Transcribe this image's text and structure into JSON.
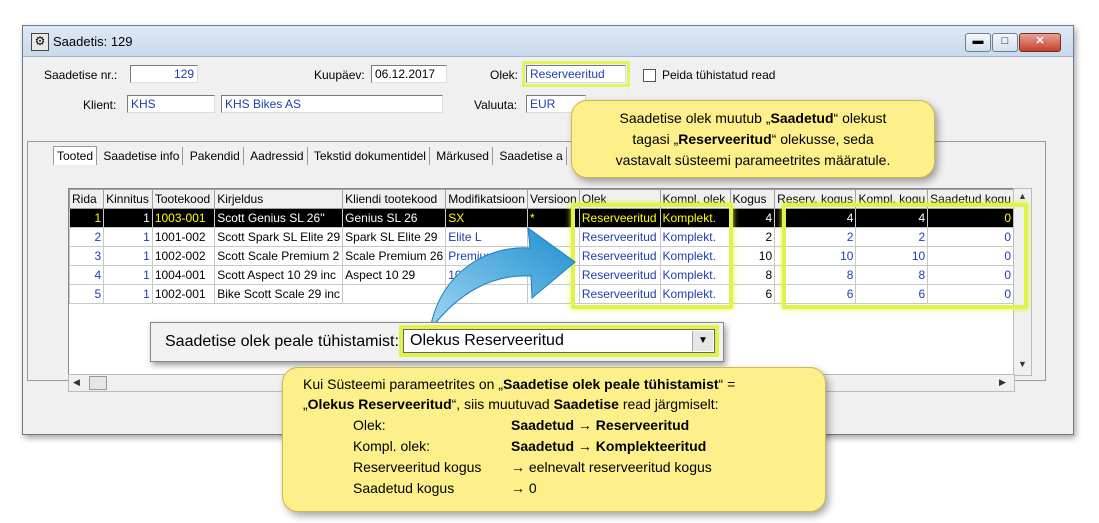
{
  "window": {
    "title": "Saadetis: 129",
    "buttons": {
      "minimize": "▬",
      "maximize": "□",
      "close": "✕"
    }
  },
  "header": {
    "saadetise_nr_label": "Saadetise nr.:",
    "saadetise_nr_value": "129",
    "kuupaev_label": "Kuupäev:",
    "kuupaev_value": "06.12.2017",
    "olek_label": "Olek:",
    "olek_value": "Reserveeritud",
    "peida_label": "Peida tühistatud read",
    "klient_label": "Klient:",
    "klient_code": "KHS",
    "klient_name": "KHS Bikes AS",
    "valuuta_label": "Valuuta:",
    "valuuta_value": "EUR"
  },
  "tabs": [
    "Tooted",
    "Saadetise info",
    "Pakendid",
    "Aadressid",
    "Tekstid dokumentidel",
    "Märkused",
    "Saadetise a"
  ],
  "table": {
    "columns": [
      "Rida",
      "Kinnitus",
      "Tootekood",
      "Kirjeldus",
      "Kliendi tootekood",
      "Modifikatsioon",
      "Versioon",
      "Olek",
      "Kompl. olek",
      "Kogus",
      "Reserv. kogus",
      "Kompl. kogu",
      "Saadetud kogu"
    ],
    "rows": [
      [
        "1",
        "1",
        "1003-001",
        "Scott Genius SL 26''",
        "Genius SL 26",
        "SX",
        "*",
        "Reserveeritud",
        "Komplekt.",
        "4",
        "4",
        "4",
        "0"
      ],
      [
        "2",
        "1",
        "1001-002",
        "Scott Spark SL Elite 29",
        "Spark SL Elite 29",
        "Elite L",
        "",
        "Reserveeritud",
        "Komplekt.",
        "2",
        "2",
        "2",
        "0"
      ],
      [
        "3",
        "1",
        "1002-002",
        "Scott Scale Premium 2",
        "Scale Premium 26",
        "Premium",
        "",
        "Reserveeritud",
        "Komplekt.",
        "10",
        "10",
        "10",
        "0"
      ],
      [
        "4",
        "1",
        "1004-001",
        "Scott Aspect 10 29 inc",
        "Aspect 10 29",
        "10",
        "",
        "Reserveeritud",
        "Komplekt.",
        "8",
        "8",
        "8",
        "0"
      ],
      [
        "5",
        "1",
        "1002-001",
        "Bike Scott Scale 29 inc",
        "",
        "",
        "",
        "Reserveeritud",
        "Komplekt.",
        "6",
        "6",
        "6",
        "0"
      ]
    ]
  },
  "dropdown": {
    "label": "Saadetise olek peale tühistamist:",
    "value": "Olekus Reserveeritud",
    "arrow": "▼"
  },
  "bubble_top": {
    "l1a": "Saadetise olek muutub „",
    "l1b": "Saadetud",
    "l1c": "“ olekust",
    "l2a": "tagasi „",
    "l2b": "Reserveeritud",
    "l2c": "“ olekusse, seda",
    "l3": "vastavalt süsteemi parameetrites määratule."
  },
  "bubble_bottom": {
    "l1a": "Kui Süsteemi parameetrites on „",
    "l1b": "Saadetise olek peale tühistamist",
    "l1c": "“ =",
    "l2a": "„",
    "l2b": "Olekus Reserveeritud",
    "l2c": "“, siis muutuvad ",
    "l2d": "Saadetise",
    "l2e": " read järgmiselt:",
    "r1k": "Olek:",
    "r1v": "Saadetud → Reserveeritud",
    "r2k": "Kompl. olek:",
    "r2v": "Saadetud → Komplekteeritud",
    "r3k": "Reserveeritud kogus",
    "r3v": "→ eelnevalt reserveeritud kogus",
    "r4k": "Saadetud kogus",
    "r4v": "→ 0"
  },
  "colors": {
    "highlight": "#e2f24a",
    "bubble": "#fdf08a",
    "arrow": "#3aa3d8",
    "text_blue": "#1d3fb0"
  }
}
